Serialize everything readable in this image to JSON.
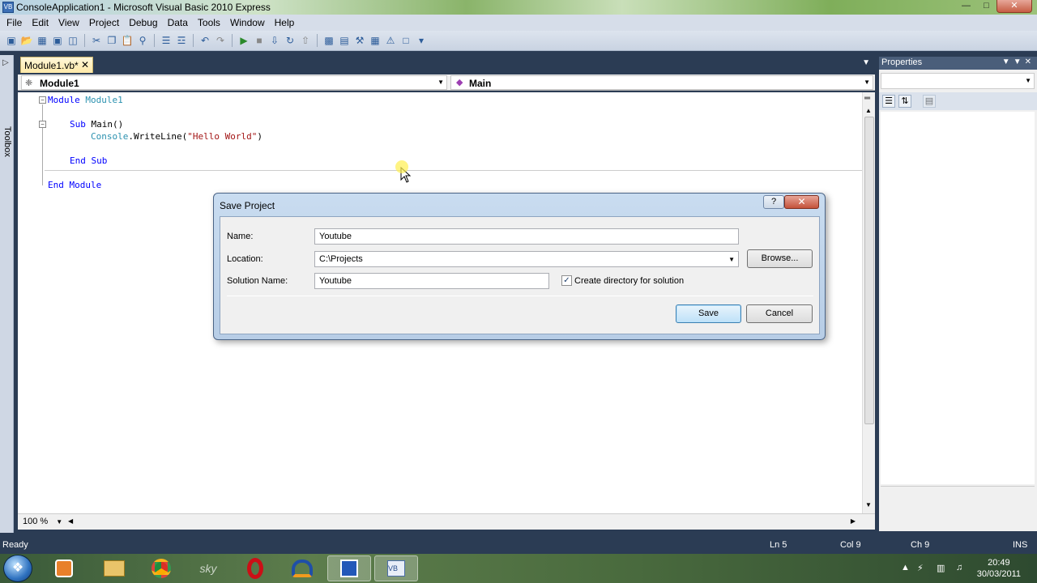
{
  "window": {
    "title": "ConsoleApplication1 - Microsoft Visual Basic 2010 Express"
  },
  "menu": [
    "File",
    "Edit",
    "View",
    "Project",
    "Debug",
    "Data",
    "Tools",
    "Window",
    "Help"
  ],
  "toolbox": {
    "label": "Toolbox"
  },
  "editor": {
    "tab_label": "Module1.vb*",
    "nav_left": "Module1",
    "nav_right": "Main",
    "code": [
      {
        "kw1": "Module",
        "rest": " Module1",
        "restClass": "ty"
      },
      {
        "kw1": "Sub",
        "rest": " Main()"
      },
      {
        "ty": "Console",
        "mid": ".WriteLine(",
        "str": "\"Hello World\"",
        "end": ")"
      },
      {
        "kw1": "End Sub"
      },
      {
        "kw1": "End Module"
      }
    ],
    "zoom": "100 %"
  },
  "properties": {
    "title": "Properties"
  },
  "status": {
    "ready": "Ready",
    "ln": "Ln 5",
    "col": "Col 9",
    "ch": "Ch 9",
    "mode": "INS"
  },
  "dialog": {
    "title": "Save Project",
    "help": "?",
    "name_label": "Name:",
    "name_value": "Youtube",
    "location_label": "Location:",
    "location_value": "C:\\Projects",
    "browse_label": "Browse...",
    "solution_label": "Solution Name:",
    "solution_value": "Youtube",
    "create_dir_label": "Create directory for solution",
    "create_dir_checked": true,
    "save_label": "Save",
    "cancel_label": "Cancel"
  },
  "taskbar": {
    "items": [
      "explorer-media",
      "file-explorer",
      "chrome",
      "sky",
      "opera",
      "audacity",
      "blue-app",
      "visual-basic"
    ],
    "time": "20:49",
    "date": "30/03/2011"
  }
}
